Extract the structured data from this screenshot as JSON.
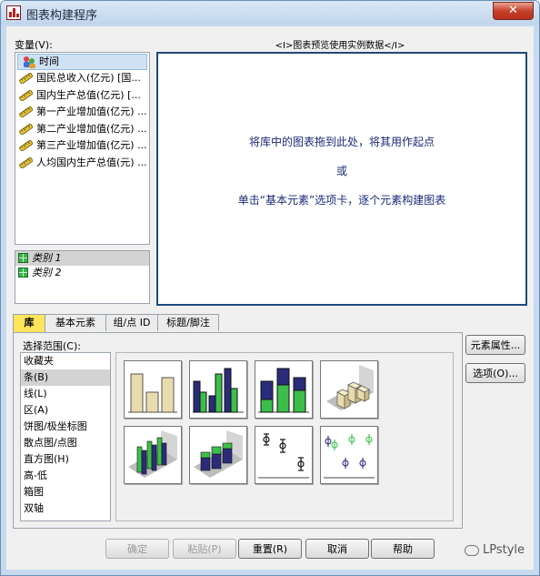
{
  "window": {
    "title": "图表构建程序",
    "close_glyph": "✕"
  },
  "variables": {
    "label": "变量(V):",
    "items": [
      {
        "label": "时间",
        "icon": "nominal-person-icon",
        "selected": true
      },
      {
        "label": "国民总收入(亿元) [国...",
        "icon": "scale-ruler-icon"
      },
      {
        "label": "国内生产总值(亿元) [...",
        "icon": "scale-ruler-icon"
      },
      {
        "label": "第一产业增加值(亿元) ...",
        "icon": "scale-ruler-icon"
      },
      {
        "label": "第二产业增加值(亿元) ...",
        "icon": "scale-ruler-icon"
      },
      {
        "label": "第三产业增加值(亿元) ...",
        "icon": "scale-ruler-icon"
      },
      {
        "label": "人均国内生产总值(元) ...",
        "icon": "scale-ruler-icon"
      }
    ]
  },
  "categories": {
    "items": [
      {
        "label": "类别 1",
        "selected": true
      },
      {
        "label": "类别 2"
      }
    ]
  },
  "preview": {
    "header": "<I>图表预览使用实例数据</I>",
    "line1": "将库中的图表拖到此处，将其用作起点",
    "line2": "或",
    "line3": "单击“基本元素”选项卡，逐个元素构建图表"
  },
  "tabs": [
    {
      "label": "库",
      "active": true
    },
    {
      "label": "基本元素"
    },
    {
      "label": "组/点 ID"
    },
    {
      "label": "标题/脚注"
    }
  ],
  "gallery": {
    "choose_label": "选择范围(C):",
    "items": [
      "收藏夹",
      "条(B)",
      "线(L)",
      "区(A)",
      "饼图/极坐标图",
      "散点图/点图",
      "直方图(H)",
      "高-低",
      "箱图",
      "双轴"
    ],
    "selected_index": 1,
    "thumbnails": [
      "simple-bar-chart-icon",
      "clustered-bar-chart-icon",
      "stacked-bar-chart-icon",
      "3d-bar-chart-icon",
      "3d-clustered-bar-chart-icon",
      "3d-stacked-bar-chart-icon",
      "error-bar-chart-icon",
      "clustered-error-bar-chart-icon"
    ]
  },
  "side_buttons": {
    "element_properties": "元素属性...",
    "options": "选项(O)..."
  },
  "bottom_buttons": {
    "ok": "确定",
    "paste": "粘贴(P)",
    "reset": "重置(R)",
    "cancel": "取消",
    "help": "帮助"
  },
  "watermark": {
    "text": "LPstyle"
  },
  "colors": {
    "bar_tan": "#e8dcae",
    "bar_navy": "#2a2c7a",
    "bar_green": "#3cbf4a",
    "canvas_border": "#1f4a7a",
    "active_tab": "#ffe45c"
  }
}
